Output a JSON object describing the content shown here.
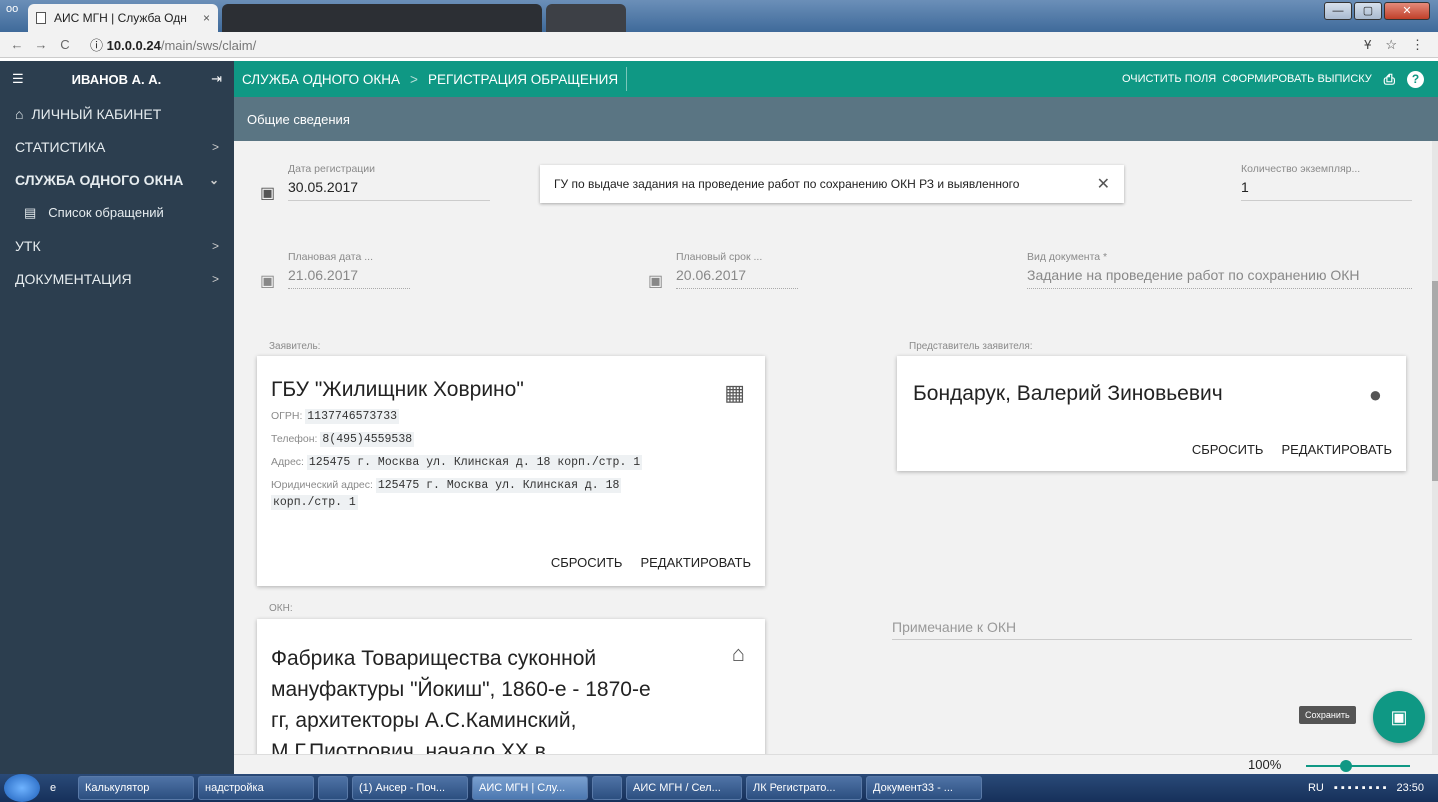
{
  "browser": {
    "tab_title": "АИС МГН | Служба Одн",
    "tab_close": "×",
    "url_host": "10.0.0.24",
    "url_path": "/main/sws/claim/"
  },
  "window": {
    "minimize": "—",
    "maximize": "▢",
    "close": "✕"
  },
  "sidebar": {
    "user": "ИВАНОВ А. А.",
    "items": [
      {
        "label": "ЛИЧНЫЙ КАБИНЕТ",
        "icon": "home-icon"
      },
      {
        "label": "СТАТИСТИКА",
        "chevron": ">"
      },
      {
        "label": "СЛУЖБА ОДНОГО ОКНА",
        "chevron": "⌄"
      },
      {
        "label": "Список обращений",
        "icon": "list-icon"
      },
      {
        "label": "УТК",
        "chevron": ">"
      },
      {
        "label": "ДОКУМЕНТАЦИЯ",
        "chevron": ">"
      }
    ]
  },
  "topbar": {
    "crumb1": "СЛУЖБА ОДНОГО ОКНА",
    "crumb_sep": ">",
    "crumb2": "РЕГИСТРАЦИЯ ОБРАЩЕНИЯ",
    "clear": "ОЧИСТИТЬ ПОЛЯ",
    "generate": "СФОРМИРОВАТЬ ВЫПИСКУ",
    "help": "?"
  },
  "section_title": "Общие сведения",
  "form": {
    "reg_date_label": "Дата регистрации",
    "reg_date": "30.05.2017",
    "service": "ГУ по выдаче задания на проведение работ по сохранению ОКН РЗ и выявленного",
    "service_clear": "✕",
    "copies_label": "Количество экземпляр...",
    "copies": "1",
    "plan_date_label": "Плановая дата ...",
    "plan_date": "21.06.2017",
    "plan_term_label": "Плановый срок ...",
    "plan_term": "20.06.2017",
    "doc_type_label": "Вид документа *",
    "doc_type": "Задание на проведение работ по сохранению ОКН"
  },
  "applicant": {
    "section_label": "Заявитель:",
    "name": "ГБУ \"Жилищник Ховрино\"",
    "ogrn_label": "ОГРН:",
    "ogrn": "1137746573733",
    "phone_label": "Телефон:",
    "phone": "8(495)4559538",
    "address_label": "Адрес:",
    "address": "125475 г. Москва ул. Клинская д. 18 корп./стр. 1",
    "legal_label": "Юридический адрес:",
    "legal_address_1": "125475 г. Москва ул. Клинская д. 18",
    "legal_address_2": "корп./стр. 1",
    "reset": "СБРОСИТЬ",
    "edit": "РЕДАКТИРОВАТЬ"
  },
  "representative": {
    "section_label": "Представитель заявителя:",
    "name": "Бондарук, Валерий Зиновьевич",
    "reset": "СБРОСИТЬ",
    "edit": "РЕДАКТИРОВАТЬ"
  },
  "okn": {
    "section_label": "ОКН:",
    "line1": "Фабрика Товарищества суконной",
    "line2": "мануфактуры \"Йокиш\", 1860-е - 1870-е",
    "line3": "гг, архитекторы А.С.Каминский,",
    "line4": "М.Г.Пиотрович, начало XX в.,",
    "note_placeholder": "Примечание к ОКН"
  },
  "save_tooltip": "Сохранить",
  "zoom": {
    "value": "100%",
    "level": 0.35
  },
  "taskbar": {
    "items": [
      "Калькулятор",
      "надстройка",
      "",
      "(1) Ансер - Поч...",
      "АИС МГН | Слу...",
      "",
      "АИС МГН / Сел...",
      "ЛК Регистрато...",
      "Документ33 - ..."
    ],
    "lang": "RU",
    "time": "23:50"
  }
}
